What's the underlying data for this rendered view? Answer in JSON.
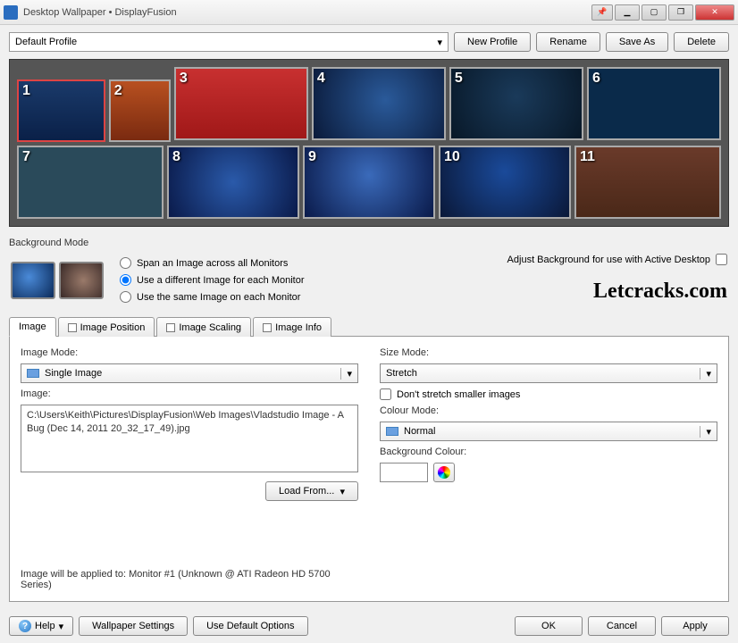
{
  "window": {
    "title": "Desktop Wallpaper • DisplayFusion"
  },
  "profile": {
    "selected": "Default Profile",
    "buttons": {
      "new": "New Profile",
      "rename": "Rename",
      "saveAs": "Save As",
      "delete": "Delete"
    }
  },
  "monitors": {
    "row1": [
      {
        "num": "1"
      },
      {
        "num": "2"
      },
      {
        "num": "3"
      },
      {
        "num": "4"
      },
      {
        "num": "5"
      },
      {
        "num": "6"
      }
    ],
    "row2": [
      {
        "num": "7"
      },
      {
        "num": "8"
      },
      {
        "num": "9"
      },
      {
        "num": "10"
      },
      {
        "num": "11"
      }
    ]
  },
  "bgMode": {
    "label": "Background Mode",
    "span": "Span an Image across all Monitors",
    "diff": "Use a different Image for each Monitor",
    "same": "Use the same Image on each Monitor",
    "activeDesktop": "Adjust Background for use with Active Desktop",
    "watermark": "Letcracks.com"
  },
  "tabs": {
    "image": "Image",
    "position": "Image Position",
    "scaling": "Image Scaling",
    "info": "Image Info"
  },
  "imageTab": {
    "imageModeLabel": "Image Mode:",
    "imageMode": "Single Image",
    "imageLabel": "Image:",
    "imagePath": "C:\\Users\\Keith\\Pictures\\DisplayFusion\\Web Images\\Vladstudio Image - A Bug (Dec 14, 2011 20_32_17_49).jpg",
    "loadFrom": "Load From...",
    "sizeModeLabel": "Size Mode:",
    "sizeMode": "Stretch",
    "dontStretch": "Don't stretch smaller images",
    "colourModeLabel": "Colour Mode:",
    "colourMode": "Normal",
    "bgColourLabel": "Background Colour:",
    "appliedTo": "Image will be applied to: Monitor #1 (Unknown @ ATI Radeon HD 5700 Series)"
  },
  "footer": {
    "help": "Help",
    "wallpaperSettings": "Wallpaper Settings",
    "defaultOptions": "Use Default Options",
    "ok": "OK",
    "cancel": "Cancel",
    "apply": "Apply"
  }
}
